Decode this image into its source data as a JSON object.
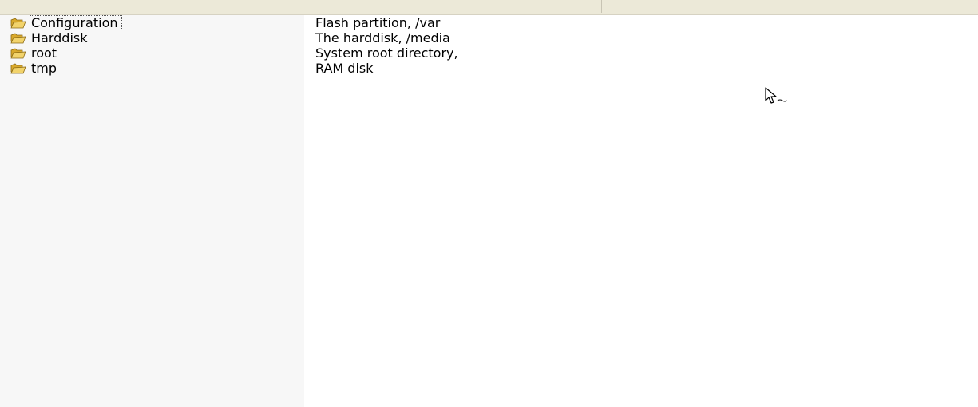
{
  "file_list": {
    "rows": [
      {
        "name": "Configuration",
        "description": "Flash partition, /var",
        "icon": "folder-icon",
        "focused": true
      },
      {
        "name": "Harddisk",
        "description": "The harddisk, /media",
        "icon": "folder-icon",
        "focused": false
      },
      {
        "name": "root",
        "description": "System root directory,",
        "icon": "folder-icon",
        "focused": false
      },
      {
        "name": "tmp",
        "description": "RAM disk",
        "icon": "folder-icon",
        "focused": false
      }
    ]
  },
  "colors": {
    "header_background": "#ece9d8",
    "name_column_background": "#f7f7f7",
    "folder_yellow": "#f2d36b"
  }
}
